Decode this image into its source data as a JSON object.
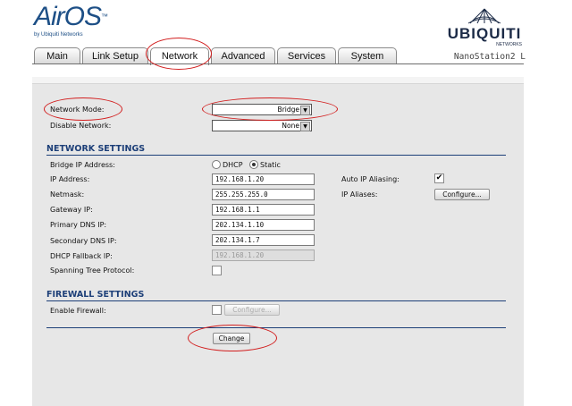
{
  "header": {
    "brand": "AirOS",
    "brand_tm": "™",
    "brand_sub": "by Ubiquiti Networks",
    "vendor": "UBIQUITI",
    "vendor_sub": "NETWORKS",
    "device_name": "NanoStation2 L"
  },
  "tabs": [
    {
      "label": "Main"
    },
    {
      "label": "Link Setup"
    },
    {
      "label": "Network",
      "active": true
    },
    {
      "label": "Advanced"
    },
    {
      "label": "Services"
    },
    {
      "label": "System"
    }
  ],
  "form": {
    "network_mode_label": "Network Mode:",
    "network_mode_value": "Bridge",
    "disable_network_label": "Disable Network:",
    "disable_network_value": "None",
    "network_settings_title": "NETWORK SETTINGS",
    "bridge_ip_label": "Bridge IP Address:",
    "dhcp_label": "DHCP",
    "static_label": "Static",
    "ip_address_label": "IP Address:",
    "ip_address_value": "192.168.1.20",
    "auto_ip_aliasing_label": "Auto IP Aliasing:",
    "netmask_label": "Netmask:",
    "netmask_value": "255.255.255.0",
    "ip_aliases_label": "IP Aliases:",
    "configure_label": "Configure...",
    "gateway_label": "Gateway IP:",
    "gateway_value": "192.168.1.1",
    "primary_dns_label": "Primary DNS IP:",
    "primary_dns_value": "202.134.1.10",
    "secondary_dns_label": "Secondary DNS IP:",
    "secondary_dns_value": "202.134.1.7",
    "dhcp_fallback_label": "DHCP Fallback IP:",
    "dhcp_fallback_value": "192.168.1.20",
    "stp_label": "Spanning Tree Protocol:",
    "firewall_title": "FIREWALL SETTINGS",
    "enable_firewall_label": "Enable Firewall:",
    "firewall_configure_label": "Configure...",
    "change_label": "Change"
  },
  "colors": {
    "accent": "#1d3f78",
    "annotation": "#d21e1e"
  }
}
